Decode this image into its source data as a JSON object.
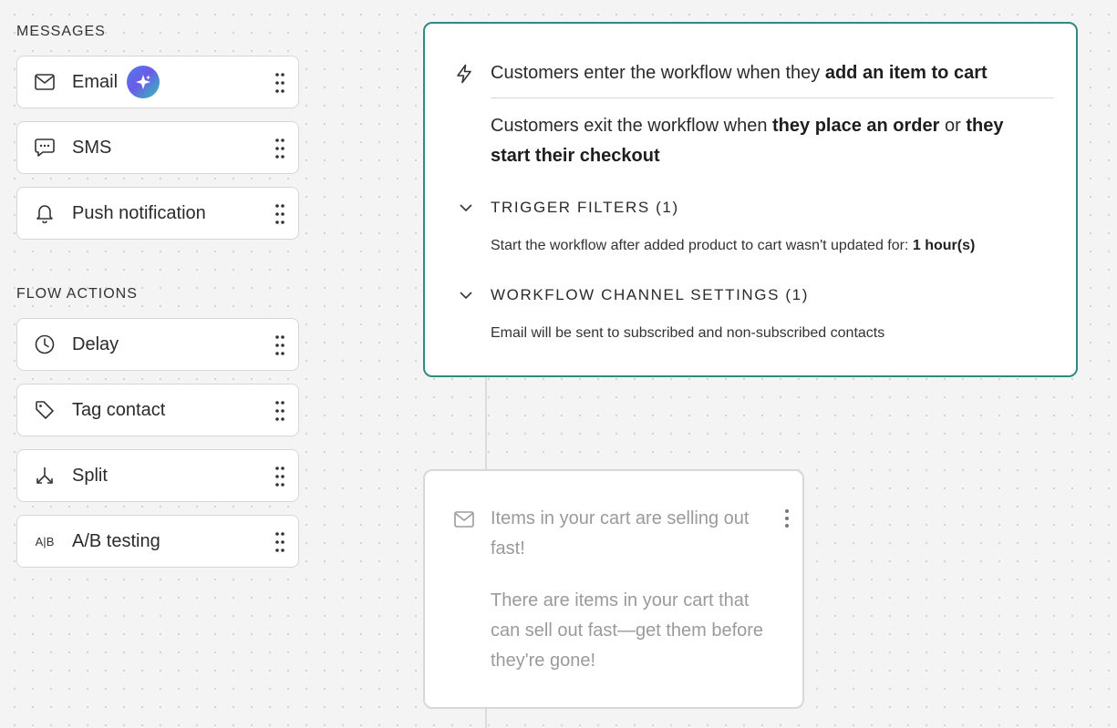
{
  "sidebar": {
    "messages_title": "MESSAGES",
    "flow_actions_title": "FLOW ACTIONS",
    "messages": [
      {
        "label": "Email",
        "icon": "mail-icon",
        "ai_badge": "sparkle-icon"
      },
      {
        "label": "SMS",
        "icon": "chat-icon"
      },
      {
        "label": "Push notification",
        "icon": "bell-icon"
      }
    ],
    "flow_actions": [
      {
        "label": "Delay",
        "icon": "clock-icon"
      },
      {
        "label": "Tag contact",
        "icon": "tag-icon"
      },
      {
        "label": "Split",
        "icon": "split-icon"
      },
      {
        "label": "A/B testing",
        "icon": "ab-icon",
        "icon_text": "A|B"
      }
    ]
  },
  "trigger": {
    "enter_prefix": "Customers enter the workflow when they ",
    "enter_bold": "add an item to cart",
    "exit_prefix": "Customers exit the workflow when ",
    "exit_bold_1": "they place an order",
    "exit_or": " or ",
    "exit_bold_2": "they",
    "exit_bold_3": "start their checkout",
    "filters_title": "TRIGGER FILTERS (1)",
    "filters_text": "Start the workflow after added product to cart wasn't updated for: ",
    "filters_value": "1 hour(s)",
    "channel_title": "WORKFLOW CHANNEL SETTINGS (1)",
    "channel_text": "Email will be sent to subscribed and non-subscribed contacts"
  },
  "message_card": {
    "subject": "Items in your cart are selling out fast!",
    "preview": "There are items in your cart that can sell out fast—get them before they're gone!"
  },
  "colors": {
    "accent": "#2f8a82",
    "muted_text": "#9a9a9a",
    "border": "#d6d6d6"
  }
}
